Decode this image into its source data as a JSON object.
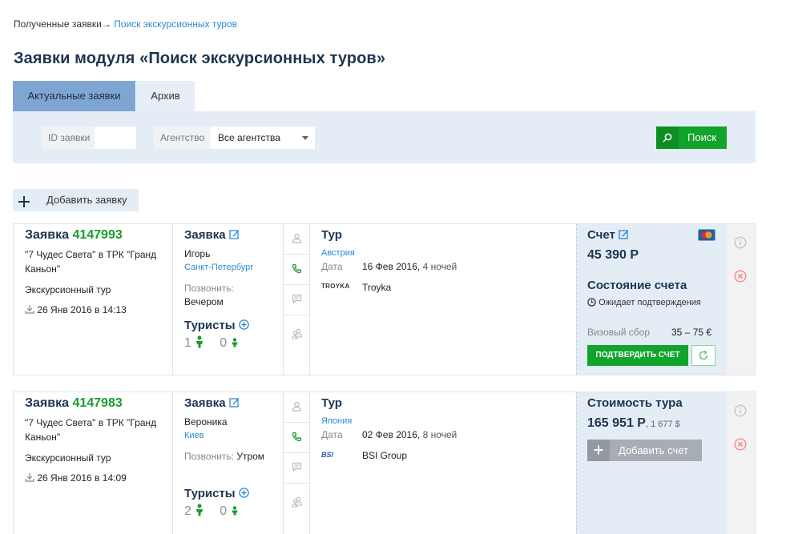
{
  "breadcrumb": {
    "parent": "Полученные заявки",
    "arrow": "→",
    "current": "Поиск экскурсионных туров"
  },
  "page_title": "Заявки модуля «Поиск экскурсионных туров»",
  "tabs": [
    {
      "label": "Актуальные заявки",
      "active": true
    },
    {
      "label": "Архив",
      "active": false
    }
  ],
  "filter": {
    "id_label": "ID заявки",
    "id_value": "",
    "agency_label": "Агентство",
    "agency_value": "Все агентства",
    "search_label": "Поиск"
  },
  "add_order_label": "Добавить заявку",
  "colors": {
    "accent": "#1a9b2e",
    "link": "#2a8ad4",
    "tab_active": "#7fa6d2",
    "heading": "#1e3550",
    "button_green": "#11a42b"
  },
  "orders": [
    {
      "title": "Заявка",
      "id": "4147993",
      "tour_name": "\"7 Чудес Света\" в ТРК \"Гранд Каньон\"",
      "tour_type": "Экскурсионный тур",
      "created": "26 Янв 2016 в 14:13",
      "client_title": "Заявка",
      "client_name": "Игорь",
      "client_city": "Санкт-Петербург",
      "call_label": "Позвонить:",
      "call_value": "Вечером",
      "tourists_label": "Туристы",
      "adults": "1",
      "children": "0",
      "tour_title": "Тур",
      "country": "Австрия",
      "date_label": "Дата",
      "date_value": "16 Фев 2016",
      "nights": "4 ночей",
      "operator_name": "Troyka",
      "operator_logo": "TROYKA",
      "bill_title": "Счет",
      "bill_amount": "45 390 Р",
      "status_title": "Состояние счета",
      "status_value": "Ожидает подтверждения",
      "visa_label": "Визовый сбор",
      "visa_value": "35 – 75 €",
      "confirm_label": "ПОДТВЕРДИТЬ СЧЕТ"
    },
    {
      "title": "Заявка",
      "id": "4147983",
      "tour_name": "\"7 Чудес Света\" в ТРК \"Гранд Каньон\"",
      "tour_type": "Экскурсионный тур",
      "created": "26 Янв 2016 в 14:09",
      "client_title": "Заявка",
      "client_name": "Вероника",
      "client_city": "Киев",
      "call_label": "Позвонить:",
      "call_value": "Утром",
      "tourists_label": "Туристы",
      "adults": "2",
      "children": "0",
      "tour_title": "Тур",
      "country": "Япония",
      "date_label": "Дата",
      "date_value": "02 Фев 2016",
      "nights": "8 ночей",
      "operator_name": "BSI Group",
      "operator_logo": "BSI",
      "cost_title": "Стоимость тура",
      "cost_rub": "165 951 Р",
      "cost_usd": "1 677 $",
      "add_bill_label": "Добавить счет"
    }
  ]
}
